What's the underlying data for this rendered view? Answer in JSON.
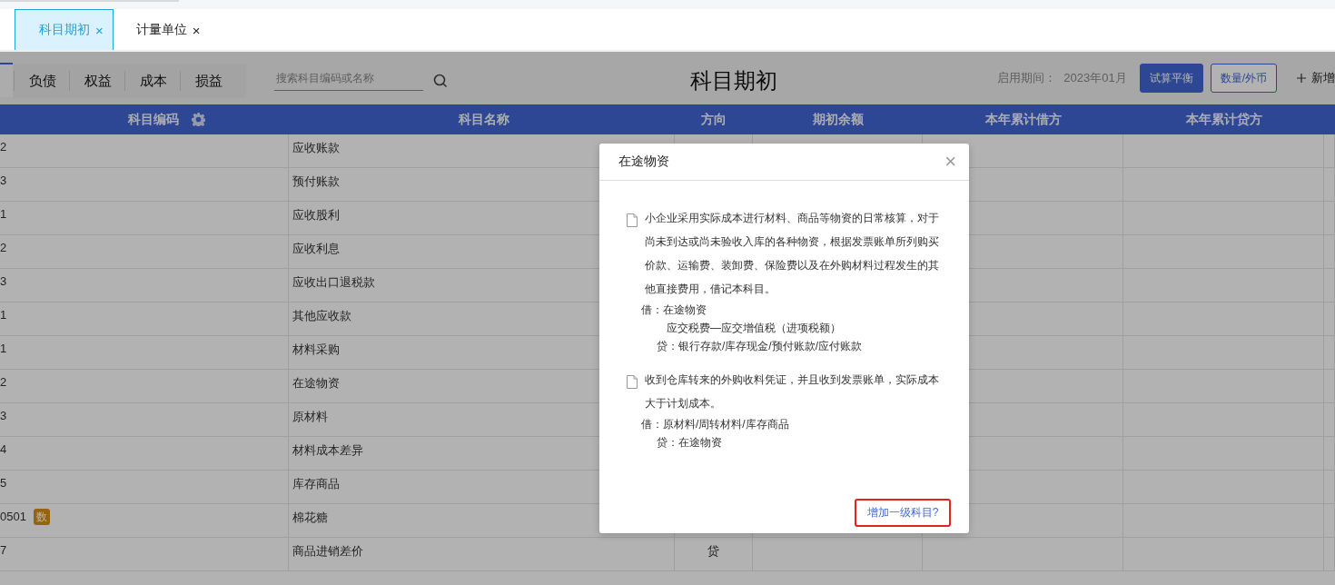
{
  "tabs": [
    {
      "label": "科目期初",
      "close": "×",
      "selected": true
    },
    {
      "label": "计量单位",
      "close": "×",
      "selected": false
    }
  ],
  "category_tabs": [
    {
      "label": "负债"
    },
    {
      "label": "权益"
    },
    {
      "label": "成本"
    },
    {
      "label": "损益"
    }
  ],
  "search": {
    "placeholder": "搜索科目编码或名称"
  },
  "title": "科目期初",
  "period": {
    "label": "启用期间：",
    "value": "2023年01月"
  },
  "buttons": [
    {
      "label": "试算平衡",
      "kind": "primary"
    },
    {
      "label": "数量/外币",
      "kind": "outline"
    },
    {
      "label": "新增",
      "kind": "add"
    }
  ],
  "table": {
    "columns": [
      "科目编码",
      "科目名称",
      "方向",
      "期初余额",
      "本年累计借方",
      "本年累计贷方"
    ],
    "rows": [
      {
        "code": "2",
        "name": "应收账款"
      },
      {
        "code": "3",
        "name": "预付账款"
      },
      {
        "code": "1",
        "name": "应收股利"
      },
      {
        "code": "2",
        "name": "应收利息"
      },
      {
        "code": "3",
        "name": "应收出口退税款"
      },
      {
        "code": "1",
        "name": "其他应收款"
      },
      {
        "code": "1",
        "name": "材料采购"
      },
      {
        "code": "2",
        "name": "在途物资"
      },
      {
        "code": "3",
        "name": "原材料"
      },
      {
        "code": "4",
        "name": "材料成本差异"
      },
      {
        "code": "5",
        "name": "库存商品"
      },
      {
        "code": "0501",
        "badge": "数",
        "name": "棉花糖"
      },
      {
        "code": "7",
        "name": "商品进销差价",
        "direction": "贷"
      }
    ]
  },
  "dialog": {
    "title": "在途物资",
    "close": "×",
    "sections": [
      {
        "text": "小企业采用实际成本进行材料、商品等物资的日常核算，对于尚未到达或尚未验收入库的各种物资，根据发票账单所列购买价款、运输费、装卸费、保险费以及在外购材料过程发生的其他直接费用，借记本科目。",
        "entries": [
          {
            "kind": "debit",
            "text": "借：在途物资"
          },
          {
            "kind": "debit-more",
            "text": "应交税费—应交增值税（进项税额）"
          },
          {
            "kind": "credit",
            "text": "贷：银行存款/库存现金/预付账款/应付账款"
          }
        ]
      },
      {
        "text": "收到仓库转来的外购收料凭证，并且收到发票账单，实际成本大于计划成本。",
        "entries": [
          {
            "kind": "debit",
            "text": "借：原材料/周转材料/库存商品"
          },
          {
            "kind": "credit",
            "text": "贷：在途物资"
          }
        ]
      }
    ],
    "link": "增加一级科目?"
  }
}
